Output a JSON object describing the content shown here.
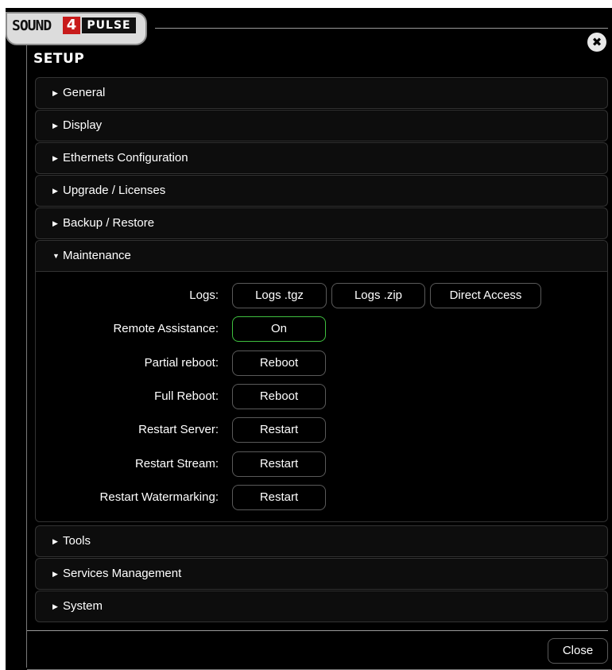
{
  "logo": {
    "sound": "SOUND",
    "four": "4",
    "pulse": "PULSE"
  },
  "dialog": {
    "title": "SETUP",
    "close_icon": "close-icon",
    "close_button": "Close"
  },
  "sections": [
    {
      "label": "General",
      "expanded": false
    },
    {
      "label": "Display",
      "expanded": false
    },
    {
      "label": "Ethernets Configuration",
      "expanded": false
    },
    {
      "label": "Upgrade / Licenses",
      "expanded": false
    },
    {
      "label": "Backup / Restore",
      "expanded": false
    },
    {
      "label": "Maintenance",
      "expanded": true
    },
    {
      "label": "Tools",
      "expanded": false
    },
    {
      "label": "Services Management",
      "expanded": false
    },
    {
      "label": "System",
      "expanded": false
    }
  ],
  "maintenance": {
    "logs": {
      "label": "Logs:",
      "buttons": [
        "Logs .tgz",
        "Logs .zip",
        "Direct Access"
      ]
    },
    "remote_assistance": {
      "label": "Remote Assistance:",
      "button": "On",
      "state_color": "#3fbf3f"
    },
    "partial_reboot": {
      "label": "Partial reboot:",
      "button": "Reboot"
    },
    "full_reboot": {
      "label": "Full Reboot:",
      "button": "Reboot"
    },
    "restart_server": {
      "label": "Restart Server:",
      "button": "Restart"
    },
    "restart_stream": {
      "label": "Restart Stream:",
      "button": "Restart"
    },
    "restart_watermarking": {
      "label": "Restart Watermarking:",
      "button": "Restart"
    }
  },
  "colors": {
    "background": "#000000",
    "accent_green": "#3fbf3f",
    "logo_red": "#c81b1b"
  }
}
